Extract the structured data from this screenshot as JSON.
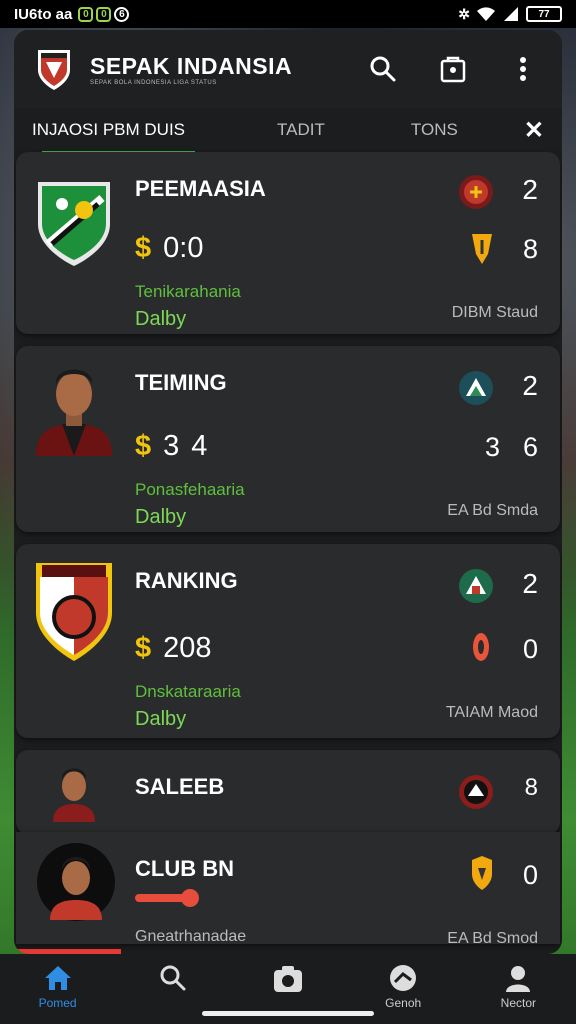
{
  "status": {
    "time": "IU6to aa",
    "battery": "77"
  },
  "app": {
    "title": "SEPAK INDANSIA",
    "subtitle": "SEPAK BOLA INDONESIA LIGA STATUS"
  },
  "tabs": [
    "INJAOSI PBM DUIS",
    "TADIT",
    "TONS"
  ],
  "cards": [
    {
      "title": "PEEMAASIA",
      "score": [
        "0",
        "0"
      ],
      "score_sep": ":",
      "desc": "Tenikarahania",
      "user": "Dalby",
      "rank": "2",
      "value": "8",
      "squad": "DIBM Staud"
    },
    {
      "title": "TEIMING",
      "score": [
        "3",
        "4"
      ],
      "desc": "Ponasfehaaria",
      "user": "Dalby",
      "rank": "2",
      "value_a": "3",
      "value_b": "6",
      "squad": "EA Bd Smda"
    },
    {
      "title": "RANKING",
      "score_single": "208",
      "desc": "Dnskataraaria",
      "user": "Dalby",
      "rank": "2",
      "value": "0",
      "squad": "TAIAM Maod"
    },
    {
      "title": "SALEEB",
      "rank_icon": "8"
    },
    {
      "title": "CLUB BN",
      "value": "0",
      "desc": "Gneatrhanadae",
      "squad": "EA Bd Smod",
      "progress": 0.35
    }
  ],
  "nav": [
    {
      "label": "Pomed",
      "icon": "home-icon",
      "active": true
    },
    {
      "label": "",
      "icon": "search-icon"
    },
    {
      "label": "",
      "icon": "camera-icon"
    },
    {
      "label": "Genoh",
      "icon": "ball-icon"
    },
    {
      "label": "Nector",
      "icon": "profile-icon"
    }
  ],
  "colors": {
    "accent_green": "#4caf50",
    "gold": "#f1c40f",
    "active_blue": "#2f8de4"
  }
}
